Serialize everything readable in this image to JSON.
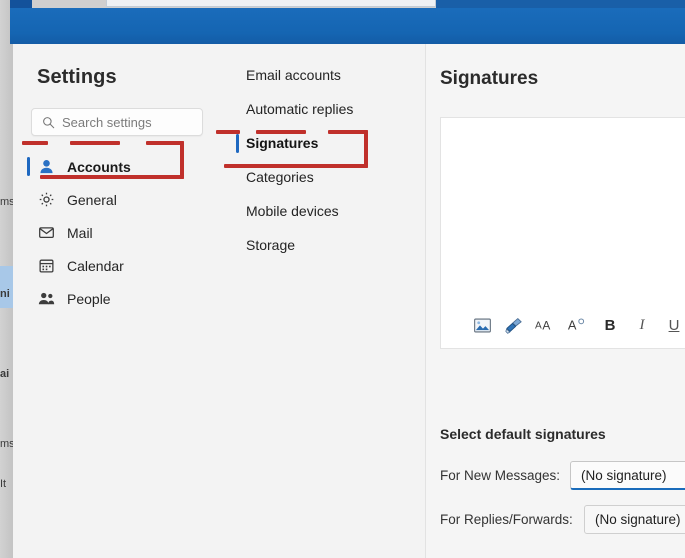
{
  "window": {
    "titlebar_color": "#1667b5",
    "dialog_bg": "#f3f3f3"
  },
  "background_window": {
    "ghost_text": [
      "ms",
      "ni",
      "ai",
      "ms",
      "It"
    ]
  },
  "settings_panel": {
    "title": "Settings",
    "search": {
      "placeholder": "Search settings",
      "icon": "search-icon"
    },
    "nav_items": [
      {
        "label": "Accounts",
        "icon": "person-icon",
        "selected": true
      },
      {
        "label": "General",
        "icon": "gear-icon",
        "selected": false
      },
      {
        "label": "Mail",
        "icon": "envelope-icon",
        "selected": false
      },
      {
        "label": "Calendar",
        "icon": "calendar-icon",
        "selected": false
      },
      {
        "label": "People",
        "icon": "people-icon",
        "selected": false
      }
    ],
    "subnav_items": [
      {
        "label": "Email accounts",
        "selected": false
      },
      {
        "label": "Automatic replies",
        "selected": false
      },
      {
        "label": "Signatures",
        "selected": true
      },
      {
        "label": "Categories",
        "selected": false
      },
      {
        "label": "Mobile devices",
        "selected": false
      },
      {
        "label": "Storage",
        "selected": false
      }
    ]
  },
  "content": {
    "title": "Signatures",
    "editor": {
      "value": "",
      "toolbar": [
        {
          "name": "insert-picture-icon",
          "glyph": ""
        },
        {
          "name": "format-painter-icon",
          "glyph": ""
        },
        {
          "name": "font-size-icon",
          "glyph": "AA"
        },
        {
          "name": "text-effects-icon",
          "glyph": "A"
        },
        {
          "name": "bold-icon",
          "glyph": "B"
        },
        {
          "name": "italic-icon",
          "glyph": "I"
        },
        {
          "name": "underline-icon",
          "glyph": "U"
        }
      ]
    },
    "defaults": {
      "heading": "Select default signatures",
      "new_messages_label": "For New Messages:",
      "new_messages_value": "(No signature)",
      "replies_label": "For Replies/Forwards:",
      "replies_value": "(No signature)"
    }
  },
  "annotations": {
    "color": "#c0302b",
    "boxes": [
      {
        "name": "accounts-highlight",
        "target": "Accounts"
      },
      {
        "name": "signatures-highlight",
        "target": "Signatures"
      }
    ]
  }
}
